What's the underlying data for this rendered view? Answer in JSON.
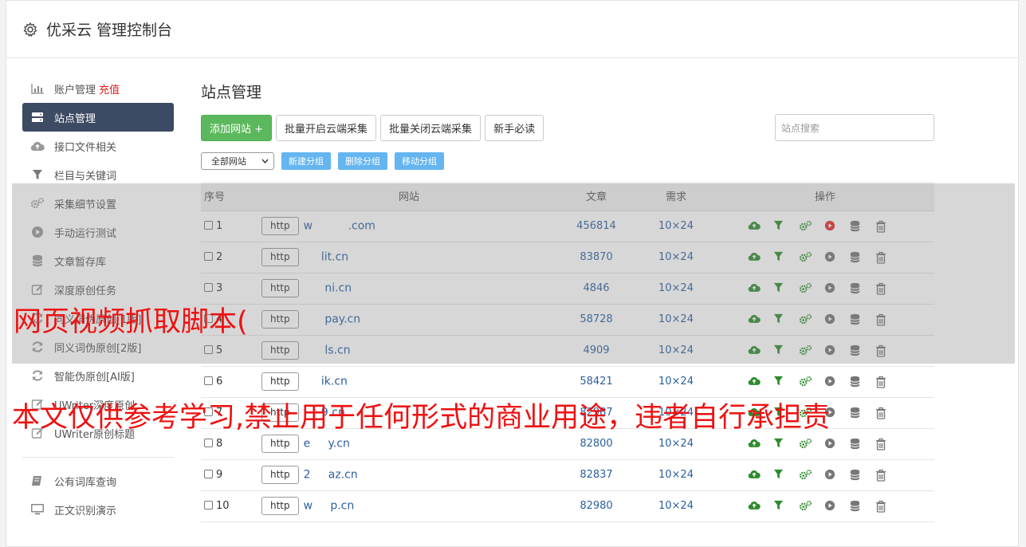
{
  "app": {
    "title": "优采云 管理控制台"
  },
  "sidebar": {
    "items": [
      {
        "label": "账户管理",
        "extra": "充值",
        "icon": "bar-chart-icon"
      },
      {
        "label": "站点管理",
        "icon": "server-icon",
        "active": true
      },
      {
        "label": "接口文件相关",
        "icon": "cloud-upload-icon"
      },
      {
        "label": "栏目与关键词",
        "icon": "filter-icon"
      },
      {
        "label": "采集细节设置",
        "icon": "cogs-icon"
      },
      {
        "label": "手动运行测试",
        "icon": "play-circle-icon"
      },
      {
        "label": "文章暂存库",
        "icon": "database-icon"
      },
      {
        "label": "深度原创任务",
        "icon": "edit-icon"
      },
      {
        "label": "同义词伪原创[1版]",
        "icon": "refresh-icon"
      },
      {
        "label": "同义词伪原创[2版]",
        "icon": "refresh-icon"
      },
      {
        "label": "智能伪原创[AI版]",
        "icon": "refresh-icon"
      },
      {
        "label": "UWriter深度原创",
        "icon": "edit-icon"
      },
      {
        "label": "UWriter原创标题",
        "icon": "edit-icon"
      }
    ],
    "bottom_items": [
      {
        "label": "公有词库查询",
        "icon": "book-icon"
      },
      {
        "label": "正文识别演示",
        "icon": "monitor-icon"
      }
    ]
  },
  "main": {
    "page_title": "站点管理",
    "buttons": {
      "add_site": "添加网站 +",
      "batch_open": "批量开启云端采集",
      "batch_close": "批量关闭云端采集",
      "guide": "新手必读"
    },
    "search_placeholder": "站点搜索",
    "group_select": "全部网站",
    "group_buttons": {
      "new": "新建分组",
      "delete": "删除分组",
      "move": "移动分组"
    },
    "table": {
      "headers": {
        "index": "序号",
        "site": "网站",
        "articles": "文章",
        "demand": "需求",
        "actions": "操作"
      },
      "rows": [
        {
          "n": "1",
          "proto": "http",
          "domain": "w          .com",
          "articles": "456814",
          "demand": "10×24",
          "running": true
        },
        {
          "n": "2",
          "proto": "http",
          "domain": "     lit.cn",
          "articles": "83870",
          "demand": "10×24",
          "running": false
        },
        {
          "n": "3",
          "proto": "http",
          "domain": "      ni.cn",
          "articles": "4846",
          "demand": "10×24",
          "running": false
        },
        {
          "n": "4",
          "proto": "http",
          "domain": "      pay.cn",
          "articles": "58728",
          "demand": "10×24",
          "running": false
        },
        {
          "n": "5",
          "proto": "http",
          "domain": "      ls.cn",
          "articles": "4909",
          "demand": "10×24",
          "running": false
        },
        {
          "n": "6",
          "proto": "http",
          "domain": "     ik.cn",
          "articles": "58421",
          "demand": "10×24",
          "running": false
        },
        {
          "n": "7",
          "proto": "http",
          "domain": "     9.cn",
          "articles": "82987",
          "demand": "10×24",
          "running": false
        },
        {
          "n": "8",
          "proto": "http",
          "domain": "e     y.cn",
          "articles": "82800",
          "demand": "10×24",
          "running": false
        },
        {
          "n": "9",
          "proto": "http",
          "domain": "2     az.cn",
          "articles": "82837",
          "demand": "10×24",
          "running": false
        },
        {
          "n": "10",
          "proto": "http",
          "domain": "w     p.cn",
          "articles": "82980",
          "demand": "10×24",
          "running": false
        }
      ]
    }
  },
  "overlay": {
    "line1": "网页视频抓取脚本(",
    "line2": "本文仅供参考学习,禁止用于任何形式的商业用途，违者自行承担责"
  },
  "colors": {
    "accent_green": "#5cb85c",
    "sidebar_active": "#3d4a63",
    "link_blue": "#2c5f9e",
    "watermark_red": "#ee1111"
  }
}
